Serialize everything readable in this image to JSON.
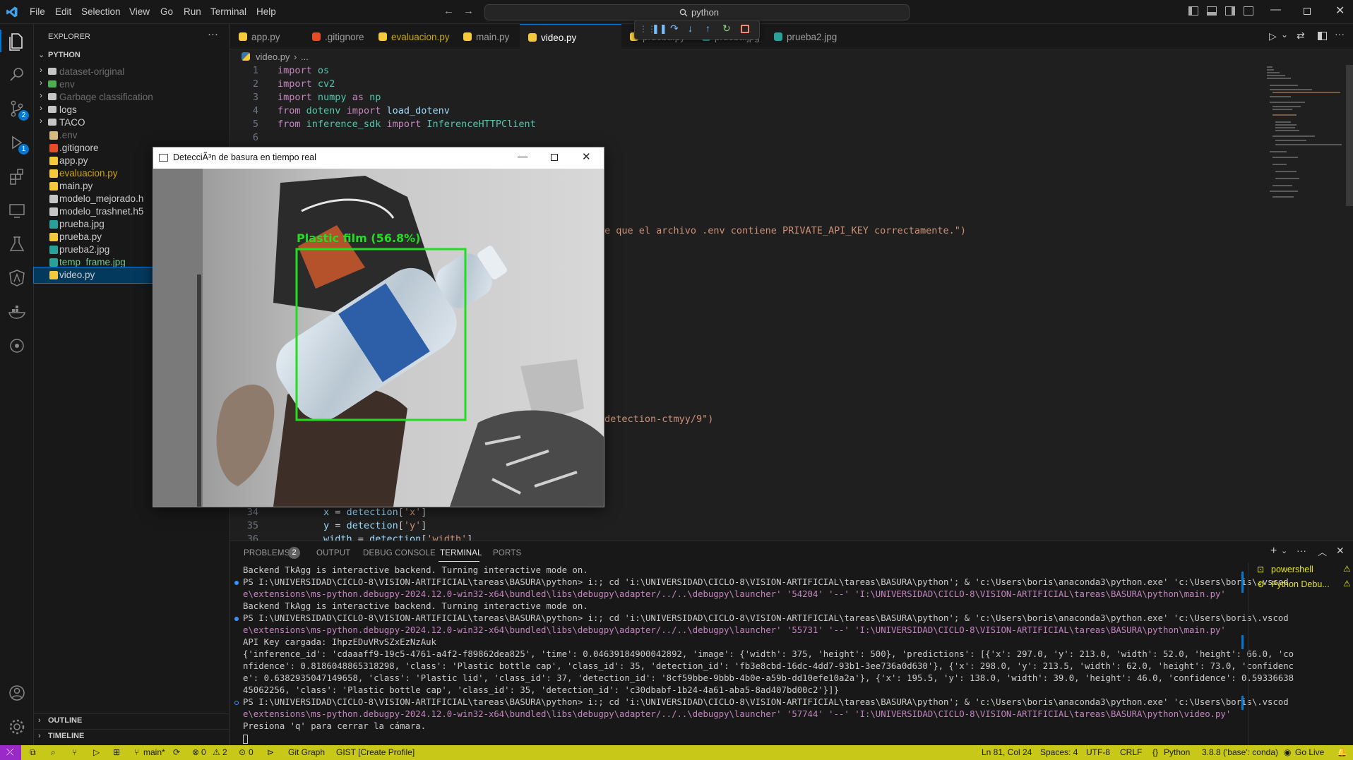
{
  "titlebar": {
    "menu": [
      "File",
      "Edit",
      "Selection",
      "View",
      "Go",
      "Run",
      "Terminal",
      "Help"
    ],
    "search_text": "python"
  },
  "activity": {
    "scm_badge": "2",
    "debug_badge": "1"
  },
  "explorer": {
    "header": "EXPLORER",
    "root": "PYTHON",
    "items": [
      {
        "label": "dataset-original",
        "type": "folder",
        "dim": true
      },
      {
        "label": "env",
        "type": "folder-green",
        "dim": true
      },
      {
        "label": "Garbage classification",
        "type": "folder",
        "dim": true
      },
      {
        "label": "logs",
        "type": "folder",
        "dim": false
      },
      {
        "label": "TACO",
        "type": "folder",
        "dim": false
      },
      {
        "label": ".env",
        "type": "env",
        "dim": true
      },
      {
        "label": ".gitignore",
        "type": "git",
        "dim": false
      },
      {
        "label": "app.py",
        "type": "py",
        "dim": false
      },
      {
        "label": "evaluacion.py",
        "type": "py",
        "dim": false,
        "warn": true
      },
      {
        "label": "main.py",
        "type": "py",
        "dim": false
      },
      {
        "label": "modelo_mejorado.h",
        "type": "file",
        "dim": false
      },
      {
        "label": "modelo_trashnet.h5",
        "type": "file",
        "dim": false
      },
      {
        "label": "prueba.jpg",
        "type": "img",
        "dim": false
      },
      {
        "label": "prueba.py",
        "type": "py",
        "dim": false
      },
      {
        "label": "prueba2.jpg",
        "type": "img",
        "dim": false
      },
      {
        "label": "temp_frame.jpg",
        "type": "img",
        "dim": false,
        "green": true
      },
      {
        "label": "video.py",
        "type": "py",
        "dim": false,
        "selected": true
      }
    ],
    "outline": "OUTLINE",
    "timeline": "TIMELINE"
  },
  "tabs": [
    {
      "label": "app.py",
      "icon": "py"
    },
    {
      "label": ".gitignore",
      "icon": "git"
    },
    {
      "label": "evaluacion.py",
      "badge": "2",
      "icon": "py",
      "warn": true
    },
    {
      "label": "main.py",
      "icon": "py"
    },
    {
      "label": "video.py",
      "icon": "py",
      "active": true
    },
    {
      "label": "prueba.py",
      "icon": "py"
    },
    {
      "label": "prueba.jpg",
      "icon": "img"
    },
    {
      "label": "prueba2.jpg",
      "icon": "img"
    }
  ],
  "breadcrumb": {
    "file": "video.py",
    "rest": "..."
  },
  "code": [
    {
      "n": "1",
      "tokens": [
        [
          "kw",
          "import"
        ],
        [
          "p",
          " "
        ],
        [
          "mod",
          "os"
        ]
      ]
    },
    {
      "n": "2",
      "tokens": [
        [
          "kw",
          "import"
        ],
        [
          "p",
          " "
        ],
        [
          "mod",
          "cv2"
        ]
      ]
    },
    {
      "n": "3",
      "tokens": [
        [
          "kw",
          "import"
        ],
        [
          "p",
          " "
        ],
        [
          "mod",
          "numpy"
        ],
        [
          "p",
          " "
        ],
        [
          "kw",
          "as"
        ],
        [
          "p",
          " "
        ],
        [
          "mod",
          "np"
        ]
      ]
    },
    {
      "n": "4",
      "tokens": [
        [
          "kw",
          "from"
        ],
        [
          "p",
          " "
        ],
        [
          "mod",
          "dotenv"
        ],
        [
          "p",
          " "
        ],
        [
          "kw",
          "import"
        ],
        [
          "p",
          " "
        ],
        [
          "id",
          "load_dotenv"
        ]
      ]
    },
    {
      "n": "5",
      "tokens": [
        [
          "kw",
          "from"
        ],
        [
          "p",
          " "
        ],
        [
          "mod",
          "inference_sdk"
        ],
        [
          "p",
          " "
        ],
        [
          "kw",
          "import"
        ],
        [
          "p",
          " "
        ],
        [
          "mod",
          "InferenceHTTPClient"
        ]
      ]
    },
    {
      "n": "6",
      "tokens": []
    }
  ],
  "code_fragments": {
    "frag1": "e que el archivo .env contiene PRIVATE_API_KEY correctamente.\")",
    "frag2": "detection-ctmyy/9\")"
  },
  "code_bottom": [
    {
      "n": "34",
      "tokens": [
        [
          "p",
          "        "
        ],
        [
          "id",
          "x"
        ],
        [
          "p",
          " = "
        ],
        [
          "id",
          "detection"
        ],
        [
          "p",
          "["
        ],
        [
          "str",
          "'x'"
        ],
        [
          "p",
          "]"
        ]
      ]
    },
    {
      "n": "35",
      "tokens": [
        [
          "p",
          "        "
        ],
        [
          "id",
          "y"
        ],
        [
          "p",
          " = "
        ],
        [
          "id",
          "detection"
        ],
        [
          "p",
          "["
        ],
        [
          "str",
          "'y'"
        ],
        [
          "p",
          "]"
        ]
      ]
    },
    {
      "n": "36",
      "tokens": [
        [
          "p",
          "        "
        ],
        [
          "id",
          "width"
        ],
        [
          "p",
          " = "
        ],
        [
          "id",
          "detection"
        ],
        [
          "p",
          "["
        ],
        [
          "str",
          "'width'"
        ],
        [
          "p",
          "]"
        ]
      ]
    }
  ],
  "panel": {
    "tabs": [
      "PROBLEMS",
      "OUTPUT",
      "DEBUG CONSOLE",
      "TERMINAL",
      "PORTS"
    ],
    "problems_badge": "2",
    "active_tab": "TERMINAL",
    "terminals": [
      "powershell",
      "Python Debu..."
    ],
    "lines": [
      "Backend TkAgg is interactive backend. Turning interactive mode on.",
      "PS I:\\UNIVERSIDAD\\CICLO-8\\VISION-ARTIFICIAL\\tareas\\BASURA\\python> i:; cd 'i:\\UNIVERSIDAD\\CICLO-8\\VISION-ARTIFICIAL\\tareas\\BASURA\\python'; & 'c:\\Users\\boris\\anaconda3\\python.exe' 'c:\\Users\\boris\\.vscod",
      "e\\extensions\\ms-python.debugpy-2024.12.0-win32-x64\\bundled\\libs\\debugpy\\adapter/../..\\debugpy\\launcher' '54204' '--' 'I:\\UNIVERSIDAD\\CICLO-8\\VISION-ARTIFICIAL\\tareas\\BASURA\\python\\main.py'",
      "Backend TkAgg is interactive backend. Turning interactive mode on.",
      "PS I:\\UNIVERSIDAD\\CICLO-8\\VISION-ARTIFICIAL\\tareas\\BASURA\\python> i:; cd 'i:\\UNIVERSIDAD\\CICLO-8\\VISION-ARTIFICIAL\\tareas\\BASURA\\python'; & 'c:\\Users\\boris\\anaconda3\\python.exe' 'c:\\Users\\boris\\.vscod",
      "e\\extensions\\ms-python.debugpy-2024.12.0-win32-x64\\bundled\\libs\\debugpy\\adapter/../..\\debugpy\\launcher' '55731' '--' 'I:\\UNIVERSIDAD\\CICLO-8\\VISION-ARTIFICIAL\\tareas\\BASURA\\python\\main.py'",
      "API Key cargada: IhpzEDuVRvSZxEzNzAuk",
      "{'inference_id': 'cdaaaff9-19c5-4761-a4f2-f89862dea825', 'time': 0.04639184900042892, 'image': {'width': 375, 'height': 500}, 'predictions': [{'x': 297.0, 'y': 213.0, 'width': 52.0, 'height': 66.0, 'co",
      "nfidence': 0.8186048865318298, 'class': 'Plastic bottle cap', 'class_id': 35, 'detection_id': 'fb3e8cbd-16dc-4dd7-93b1-3ee736a0d630'}, {'x': 298.0, 'y': 213.5, 'width': 62.0, 'height': 73.0, 'confidenc",
      "e': 0.6382935047149658, 'class': 'Plastic lid', 'class_id': 37, 'detection_id': '8cf59bbe-9bbb-4b0e-a59b-dd10efe10a2a'}, {'x': 195.5, 'y': 138.0, 'width': 39.0, 'height': 46.0, 'confidence': 0.59336638",
      "45062256, 'class': 'Plastic bottle cap', 'class_id': 35, 'detection_id': 'c30dbabf-1b24-4a61-aba5-8ad407bd00c2'}]}",
      "PS I:\\UNIVERSIDAD\\CICLO-8\\VISION-ARTIFICIAL\\tareas\\BASURA\\python> i:; cd 'i:\\UNIVERSIDAD\\CICLO-8\\VISION-ARTIFICIAL\\tareas\\BASURA\\python'; & 'c:\\Users\\boris\\anaconda3\\python.exe' 'c:\\Users\\boris\\.vscod",
      "e\\extensions\\ms-python.debugpy-2024.12.0-win32-x64\\bundled\\libs\\debugpy\\adapter/../..\\debugpy\\launcher' '57744' '--' 'I:\\UNIVERSIDAD\\CICLO-8\\VISION-ARTIFICIAL\\tareas\\BASURA\\python\\video.py'",
      "Presiona 'q' para cerrar la cámara."
    ]
  },
  "cv_window": {
    "title": "DetecciÃ³n de basura en tiempo real",
    "detection_label": "Plastic film (56.8%)",
    "box_color": "#22dd22"
  },
  "statusbar": {
    "branch": "main*",
    "errors": "0",
    "warnings": "2",
    "ports": "0",
    "git_graph": "Git Graph",
    "gist": "GIST [Create Profile]",
    "position": "Ln 81, Col 24",
    "spaces": "Spaces: 4",
    "encoding": "UTF-8",
    "eol": "CRLF",
    "language": "Python",
    "interpreter": "3.8.8 ('base': conda)",
    "golive": "Go Live"
  },
  "colors": {
    "accent": "#0078d4",
    "statusbar": "#c8c819",
    "selection": "#04395e"
  }
}
